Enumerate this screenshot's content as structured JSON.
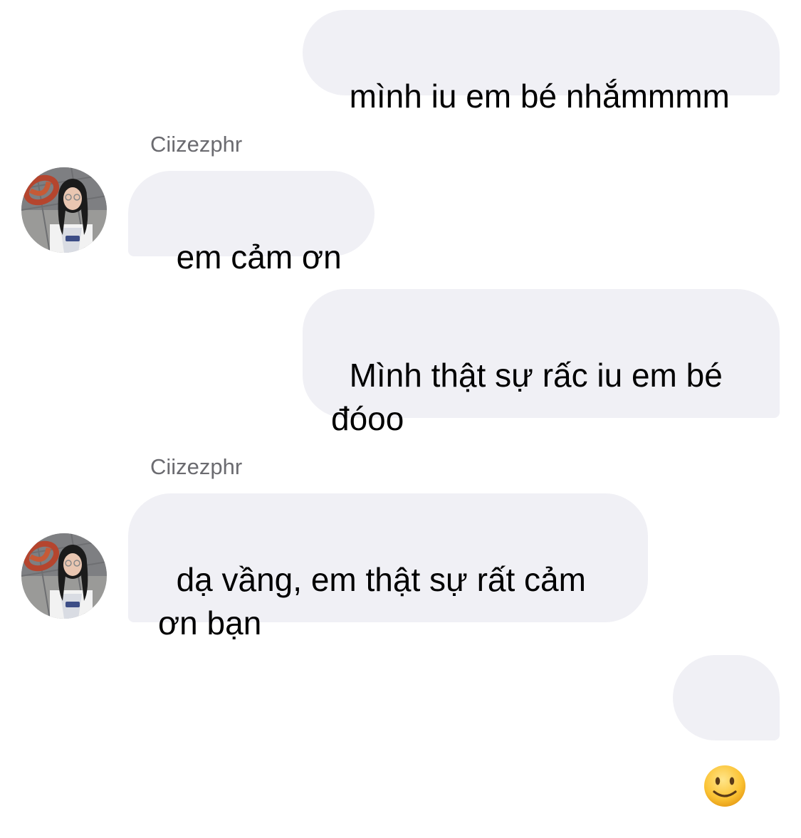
{
  "conversation": {
    "messages": [
      {
        "direction": "outgoing",
        "text": "mình iu em bé nhắmmmm"
      },
      {
        "direction": "incoming",
        "sender": "Ciizezphr",
        "text": "em cảm ơn"
      },
      {
        "direction": "outgoing",
        "text": "Mình thật sự rấc iu em bé đóoo"
      },
      {
        "direction": "incoming",
        "sender": "Ciizezphr",
        "text": "dạ vầng, em thật sự rất cảm ơn bạn"
      },
      {
        "direction": "outgoing",
        "emoji": "slightly-smiling-face-icon"
      }
    ]
  },
  "colors": {
    "bubble": "#f0f0f5",
    "sender_name": "#6b6b70",
    "text": "#000000"
  }
}
